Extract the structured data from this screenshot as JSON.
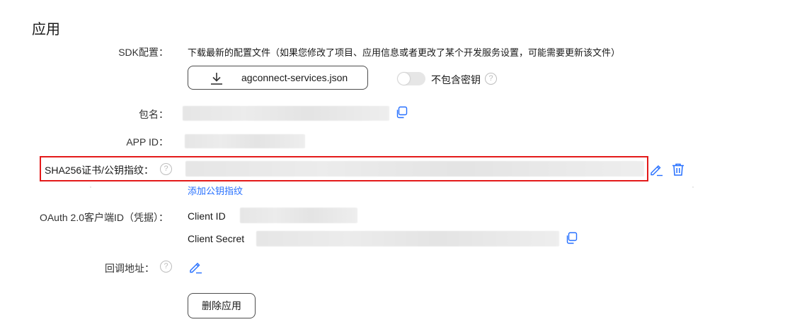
{
  "page": {
    "title": "应用"
  },
  "sdk": {
    "label": "SDK配置：",
    "description": "下载最新的配置文件（如果您修改了项目、应用信息或者更改了某个开发服务设置，可能需要更新该文件）",
    "download_label": "agconnect-services.json",
    "toggle_label": "不包含密钥",
    "toggle_on": false
  },
  "package": {
    "label": "包名："
  },
  "app_id": {
    "label": "APP ID："
  },
  "sha256": {
    "label": "SHA256证书/公钥指纹：",
    "add_link": "添加公钥指纹"
  },
  "oauth": {
    "label": "OAuth 2.0客户端ID（凭据）：",
    "client_id_label": "Client ID",
    "client_secret_label": "Client Secret"
  },
  "callback": {
    "label": "回调地址："
  },
  "actions": {
    "delete_label": "删除应用"
  },
  "colors": {
    "link": "#256fff",
    "highlight_border": "#e31919",
    "icon_blue": "#256fff"
  },
  "icons": [
    "download-icon",
    "help-icon",
    "copy-icon",
    "edit-icon",
    "trash-icon"
  ]
}
